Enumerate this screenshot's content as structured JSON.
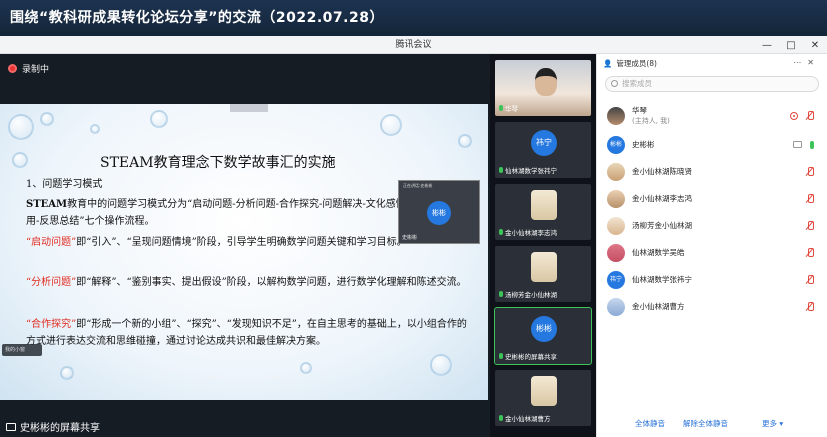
{
  "banner": {
    "title": "围绕“教科研成果转化论坛分享”的交流（2022.07.28）"
  },
  "window": {
    "title": "腾讯会议",
    "controls": [
      "—",
      "□",
      "✕"
    ]
  },
  "main": {
    "recording_label": "录制中",
    "share_label": "史彬彬的屏幕共享",
    "pip": {
      "title": "正在讲话:史彬彬",
      "avatar": "彬彬",
      "name": "史彬彬"
    },
    "speaker_chip": "我的小窗",
    "slide": {
      "title": "STEAM教育理念下数学故事汇的实施",
      "section": "1、问题学习模式",
      "p1_bold": "STEAM",
      "p1": "教育中的问题学习模式分为“启动问题-分析问题-合作探究-问题解决-文化感悟-多维拓展与应用-反思总结”七个操作流程。",
      "p2_red": "“启动问题”",
      "p2": "即“引入”、“呈现问题情境”阶段，引导学生明确数学问题关键和学习目标。",
      "p3_red": "“分析问题”",
      "p3": "即“解释”、“鉴别事实、提出假设”阶段，以解构数学问题，进行数学化理解和陈述交流。",
      "p4_red": "“合作探究”",
      "p4": "即“形成一个新的小组”、“探究”、“发现知识不足”，在自主思考的基础上，以小组合作的方式进行表达交流和思维碰撞，通过讨论达成共识和最佳解决方案。"
    }
  },
  "thumbs": [
    {
      "name": "华琴",
      "kind": "video"
    },
    {
      "name": "仙林湖数学张祎宁",
      "avatar": "祎宁",
      "kind": "avatar"
    },
    {
      "name": "金小仙林湖李志鸿",
      "kind": "photo"
    },
    {
      "name": "汤柳芳金小仙林湖",
      "kind": "photo"
    },
    {
      "name": "史彬彬的屏幕共享",
      "avatar": "彬彬",
      "kind": "avatar"
    },
    {
      "name": "金小仙林湖曹方",
      "kind": "photo"
    }
  ],
  "panel": {
    "title": "管理成员(8)",
    "search_placeholder": "搜索成员",
    "members": [
      {
        "name": "华琴",
        "sub": "(主持人, 我)",
        "avatar_class": "photo1"
      },
      {
        "name": "史彬彬",
        "avatar": "彬彬",
        "avatar_class": "blue"
      },
      {
        "name": "金小仙林湖陈晓贤",
        "avatar_class": "photo2"
      },
      {
        "name": "金小仙林湖李志鸿",
        "avatar_class": "photo3"
      },
      {
        "name": "汤柳芳金小仙林湖",
        "avatar_class": "photo4"
      },
      {
        "name": "仙林湖数学吴皓",
        "avatar_class": "photo5"
      },
      {
        "name": "仙林湖数学张祎宁",
        "avatar": "祎宁",
        "avatar_class": "blue"
      },
      {
        "name": "金小仙林湖曹方",
        "avatar_class": "photo6"
      }
    ],
    "footer": {
      "mute_all": "全体静音",
      "unmute_all": "解除全体静音",
      "more": "更多 ▾"
    }
  }
}
